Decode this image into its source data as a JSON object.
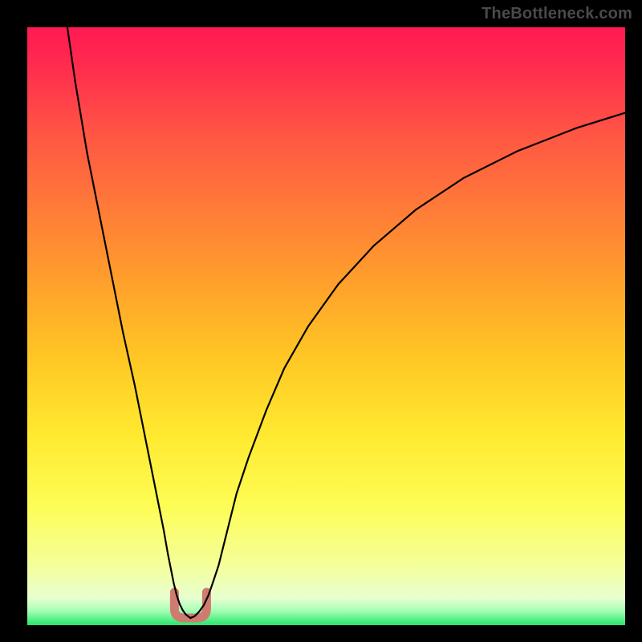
{
  "watermark": "TheBottleneck.com",
  "chart_data": {
    "type": "line",
    "title": "",
    "xlabel": "",
    "ylabel": "",
    "xlim": [
      0,
      100
    ],
    "ylim": [
      0,
      100
    ],
    "grid": false,
    "legend": false,
    "series": [
      {
        "name": "curve-left",
        "x": [
          6.7,
          8,
          10,
          12,
          14,
          16,
          18,
          20,
          21,
          22,
          22.8,
          23.5,
          24,
          24.5,
          25,
          25.5,
          26,
          26.5,
          27,
          27.3
        ],
        "y": [
          100,
          91,
          79,
          69,
          59,
          49,
          40,
          30,
          25,
          20,
          16,
          12,
          9.5,
          7,
          5,
          3.5,
          2.5,
          1.8,
          1.4,
          1.2
        ]
      },
      {
        "name": "curve-right",
        "x": [
          27.3,
          28,
          28.7,
          29.5,
          30.3,
          31,
          32,
          33,
          34,
          35,
          37,
          40,
          43,
          47,
          52,
          58,
          65,
          73,
          82,
          92,
          100
        ],
        "y": [
          1.2,
          1.5,
          2.2,
          3.3,
          5,
          7,
          10,
          14,
          18,
          22,
          28,
          36,
          43,
          50,
          57,
          63.5,
          69.5,
          74.8,
          79.3,
          83.2,
          85.7
        ]
      },
      {
        "name": "green-band-top",
        "x": [
          0,
          100
        ],
        "y": [
          3.4,
          3.4
        ]
      }
    ],
    "annotations": [
      {
        "type": "u-marker",
        "x": 27.3,
        "y_top": 5.5,
        "y_bottom": 1.2,
        "color": "#cf7b70"
      }
    ],
    "background_gradient": {
      "stops": [
        {
          "pos": 0.0,
          "color": "#ff1a52"
        },
        {
          "pos": 0.06,
          "color": "#ff2a4f"
        },
        {
          "pos": 0.18,
          "color": "#ff5644"
        },
        {
          "pos": 0.3,
          "color": "#ff7a38"
        },
        {
          "pos": 0.42,
          "color": "#ff9e2c"
        },
        {
          "pos": 0.55,
          "color": "#ffc624"
        },
        {
          "pos": 0.68,
          "color": "#ffe92f"
        },
        {
          "pos": 0.8,
          "color": "#fdfd55"
        },
        {
          "pos": 0.9,
          "color": "#f4ff9a"
        },
        {
          "pos": 0.955,
          "color": "#e7ffd0"
        },
        {
          "pos": 0.975,
          "color": "#a8ffb8"
        },
        {
          "pos": 1.0,
          "color": "#27e66a"
        }
      ]
    }
  }
}
